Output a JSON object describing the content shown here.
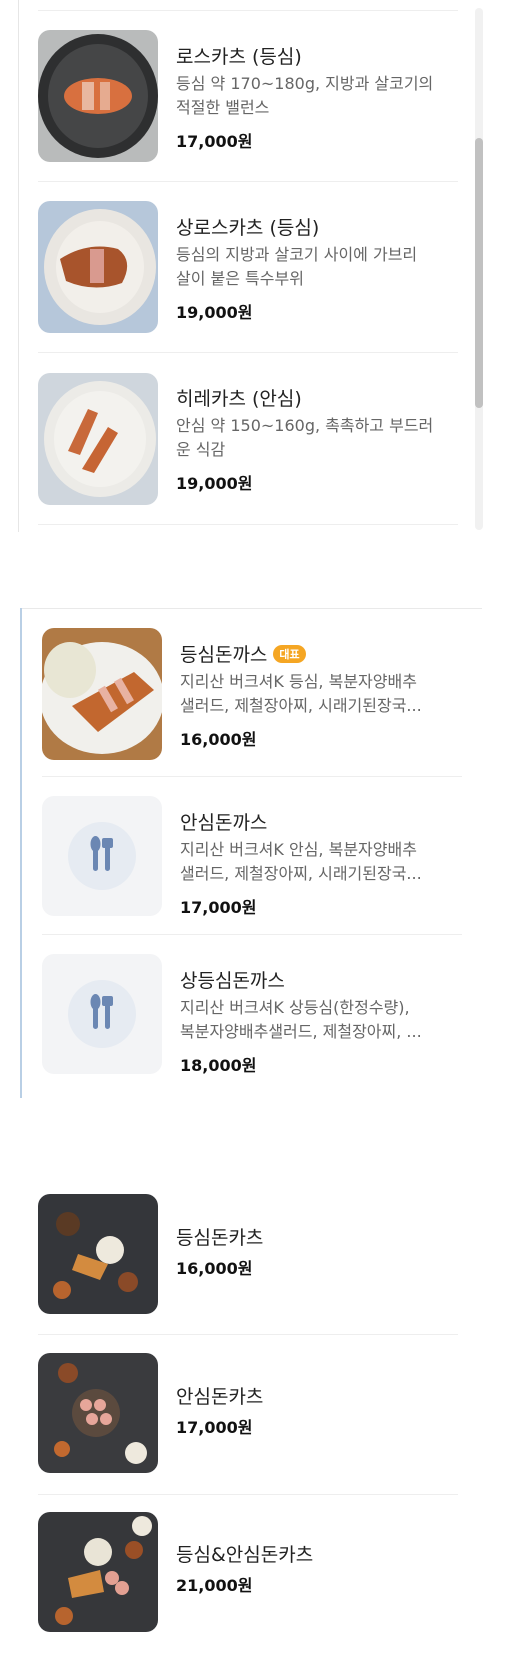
{
  "section1": {
    "items": [
      {
        "name": "로스카츠 (등심)",
        "desc_line1": "등심 약 170~180g, 지방과 살코기의",
        "desc_line2": "적절한 밸런스",
        "price": "17,000원"
      },
      {
        "name": "상로스카츠 (등심)",
        "desc_line1": "등심의 지방과 살코기 사이에 가브리",
        "desc_line2": "살이 붙은 특수부위",
        "price": "19,000원"
      },
      {
        "name": "히레카츠 (안심)",
        "desc_line1": "안심 약 150~160g, 촉촉하고 부드러",
        "desc_line2": "운 식감",
        "price": "19,000원"
      }
    ]
  },
  "section2": {
    "items": [
      {
        "name": "등심돈까스",
        "badge": "대표",
        "desc_line1": "지리산 버크셔K 등심, 복분자양배추",
        "desc_line2": "샐러드, 제철장아찌, 시래기된장국...",
        "price": "16,000원"
      },
      {
        "name": "안심돈까스",
        "desc_line1": "지리산 버크셔K 안심, 복분자양배추",
        "desc_line2": "샐러드, 제철장아찌, 시래기된장국...",
        "price": "17,000원"
      },
      {
        "name": "상등심돈까스",
        "desc_line1": "지리산 버크셔K 상등심(한정수량),",
        "desc_line2": "복분자양배추샐러드, 제철장아찌, ...",
        "price": "18,000원"
      }
    ]
  },
  "section3": {
    "items": [
      {
        "name": "등심돈카츠",
        "price": "16,000원"
      },
      {
        "name": "안심돈카츠",
        "price": "17,000원"
      },
      {
        "name": "등심&안심돈카츠",
        "price": "21,000원"
      }
    ]
  }
}
